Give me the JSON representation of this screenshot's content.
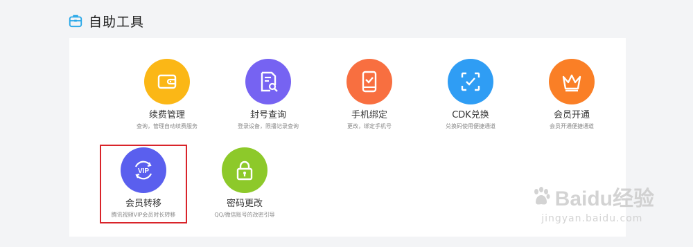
{
  "header": {
    "title": "自助工具",
    "icon": "toolbox-icon"
  },
  "tools": [
    {
      "name": "续费管理",
      "desc": "查询，管理自动续费服务",
      "color": "#fbb716",
      "icon": "wallet-icon"
    },
    {
      "name": "封号查询",
      "desc": "登录设备，限播记录查询",
      "color": "#7663f2",
      "icon": "document-search-icon"
    },
    {
      "name": "手机绑定",
      "desc": "更改，绑定手机号",
      "color": "#f86f40",
      "icon": "phone-check-icon"
    },
    {
      "name": "CDK兑换",
      "desc": "兑换码使用便捷通道",
      "color": "#2f9df4",
      "icon": "scan-check-icon"
    },
    {
      "name": "会员开通",
      "desc": "会员开通便捷通道",
      "color": "#fa7f26",
      "icon": "crown-icon"
    },
    {
      "name": "会员转移",
      "desc": "腾讯视频VIP会员时长转移",
      "color": "#5a5fee",
      "icon": "vip-transfer-icon"
    },
    {
      "name": "密码更改",
      "desc": "QQ/微信账号的改密引导",
      "color": "#8dc92a",
      "icon": "lock-icon"
    }
  ],
  "watermark": {
    "main": "Baidu经验",
    "sub": "jingyan.baidu.com"
  },
  "highlight_color": "#d9242a"
}
